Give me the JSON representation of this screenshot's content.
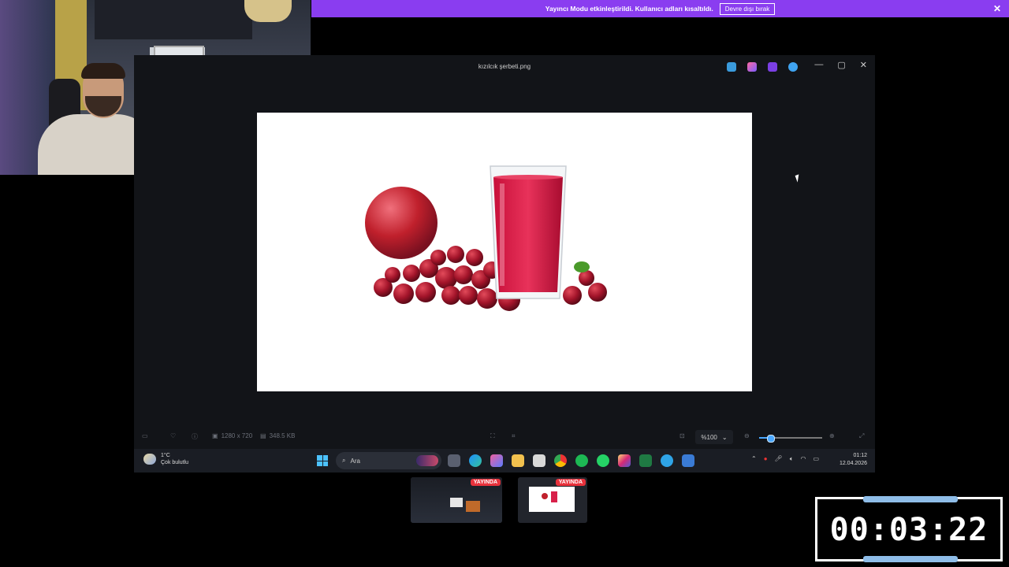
{
  "banner": {
    "message": "Yayıncı Modu etkinleştirildi. Kullanıcı adları kısaltıldı.",
    "button_label": "Devre dışı bırak",
    "close_icon": "close-icon",
    "color": "#8a3df0"
  },
  "viewer": {
    "file_name": "kızılcık şerbeti.png",
    "window_controls": {
      "minimize": "—",
      "maximize": "▢",
      "close": "✕"
    },
    "image_info": {
      "dimensions": "1280 x 720",
      "size": "348.5 KB"
    },
    "zoom": {
      "label": "%100",
      "value_percent": 100,
      "slider_fraction": 0.18
    }
  },
  "taskbar": {
    "weather": {
      "temp": "1°C",
      "condition": "Çok bulutlu"
    },
    "search_placeholder": "Ara",
    "clock": {
      "time": "01:12",
      "date": "12.04.2026"
    }
  },
  "stream": {
    "thumb_badge_1": "YAYINDA",
    "thumb_badge_2": "YAYINDA",
    "timer": "00:03:22"
  }
}
